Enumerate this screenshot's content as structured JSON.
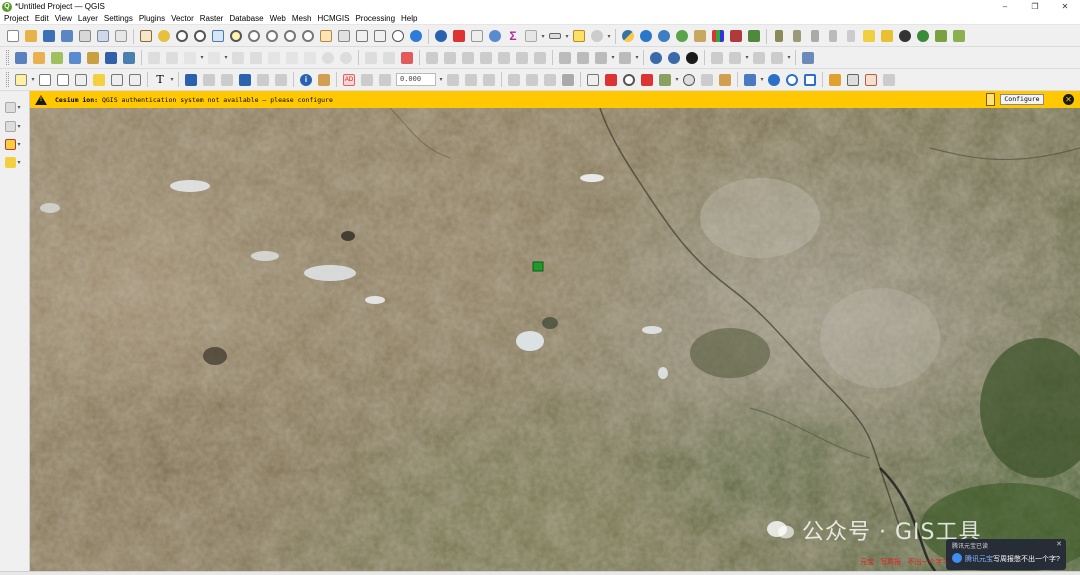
{
  "window": {
    "title": "*Untitled Project — QGIS",
    "logo_letter": "Q",
    "minimize": "–",
    "maximize": "❐",
    "close": "✕"
  },
  "menubar": [
    "Project",
    "Edit",
    "View",
    "Layer",
    "Settings",
    "Plugins",
    "Vector",
    "Raster",
    "Database",
    "Web",
    "Mesh",
    "HCMGIS",
    "Processing",
    "Help"
  ],
  "toolbars": {
    "sigma": "Σ",
    "label_badge": "AD",
    "rotation_value": "0.000",
    "identify_label": "i",
    "text_tool": "T"
  },
  "notification": {
    "source": "Cesium ion:",
    "message": "QGIS authentication system not available — please configure",
    "button": "Configure",
    "close": "✕",
    "warn": "!"
  },
  "watermark": {
    "text": "公众号 · GIS工具"
  },
  "chat_popup": {
    "title": "腾讯元宝已读",
    "name": "腾讯元宝",
    "message": "写周报憋不出一个字?",
    "close": "✕"
  },
  "status_overlay_text": "元宝 · 写周报 · 不出一个字?",
  "colors": {
    "notification_bg": "#ffc800",
    "accent_green": "#5a9b2a",
    "map_marker": "#1f9a2c"
  }
}
